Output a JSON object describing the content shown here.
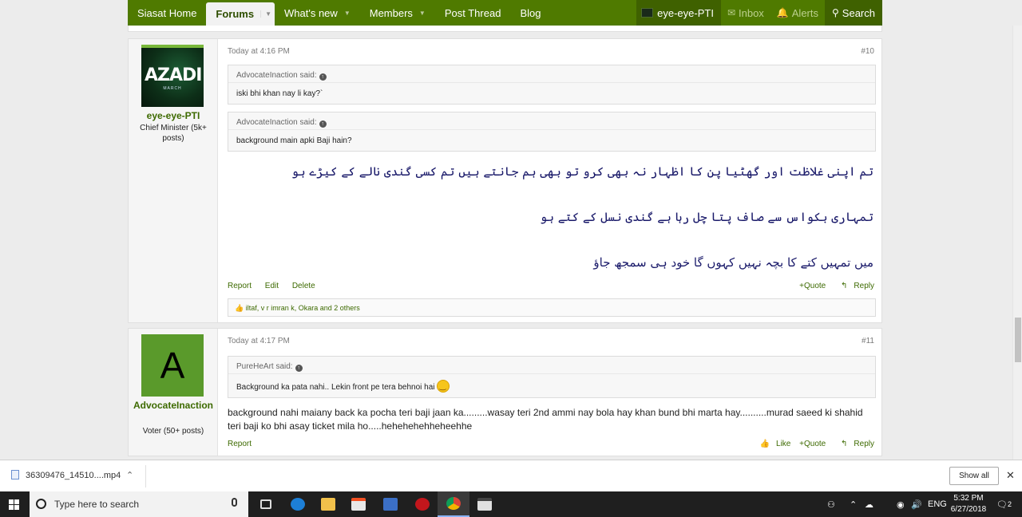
{
  "nav": {
    "items": [
      "Siasat Home",
      "Forums",
      "What's new",
      "Members",
      "Post Thread",
      "Blog"
    ],
    "user": "eye-eye-PTI",
    "inbox": "Inbox",
    "alerts": "Alerts",
    "search": "Search"
  },
  "posts": [
    {
      "author": "eye-eye-PTI",
      "user_title": "Chief Minister (5k+ posts)",
      "avatar_text": "AZADI",
      "avatar_sub": "MARCH",
      "time": "Today at 4:16 PM",
      "number": "#10",
      "quotes": [
        {
          "header": "AdvocateInaction said:",
          "body": "iski bhi khan nay li kay?`"
        },
        {
          "header": "AdvocateInaction said:",
          "body": "background main apki Baji hain?"
        }
      ],
      "urdu_lines": [
        "تم اپنی غلاظت اور گھٹیا پن کا اظہار نہ بھی کرو تو بھی ہم جانتے ہیں تم کسی گندی نالے کے کیڑے ہو",
        "تمہاری بکواس سے صاف پتا چل رہا ہے گندی نسل کے کتے ہو",
        "میں تمہیں کتے کا بچہ نہیں کہوں گا خود ہی سمجھ جاؤ"
      ],
      "actions_left": [
        "Report",
        "Edit",
        "Delete"
      ],
      "actions_right": [
        "+Quote",
        "Reply"
      ],
      "likes": "iltaf, v r imran k, Okara and 2 others"
    },
    {
      "author": "AdvocateInaction",
      "user_title": "Voter (50+ posts)",
      "avatar_letter": "A",
      "time": "Today at 4:17 PM",
      "number": "#11",
      "quotes": [
        {
          "header": "PureHeArt said:",
          "body": "Background ka pata nahi.. Lekin front pe tera behnoi hai"
        }
      ],
      "body": "background nahi maiany back ka pocha teri baji jaan ka.........wasay teri 2nd ammi nay bola hay khan bund bhi marta hay..........murad saeed ki shahid teri baji ko bhi asay ticket mila ho.....hehehehehheheehhe",
      "actions_left": [
        "Report"
      ],
      "actions_right": [
        "Like",
        "+Quote",
        "Reply"
      ]
    }
  ],
  "download": {
    "file": "36309476_14510....mp4",
    "show_all": "Show all"
  },
  "taskbar": {
    "search_placeholder": "Type here to search",
    "lang": "ENG",
    "time": "5:32 PM",
    "date": "6/27/2018",
    "notif_count": "2"
  }
}
